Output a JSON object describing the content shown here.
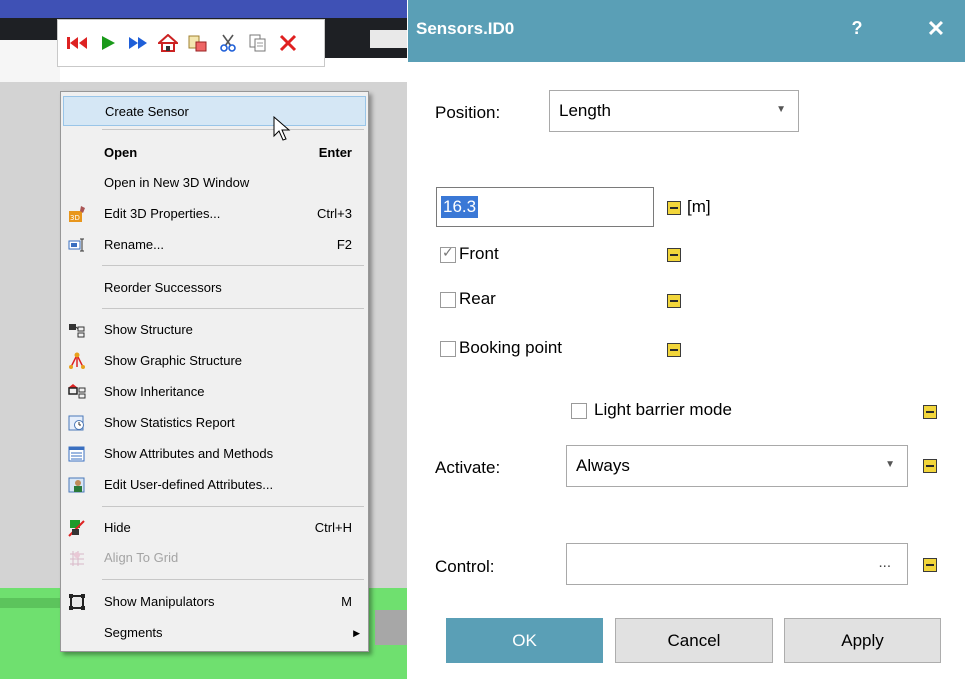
{
  "toolbar": {
    "icons": [
      "reset-icon",
      "play-icon",
      "fast-forward-icon",
      "home-icon",
      "paste-special-icon",
      "cut-icon",
      "copy-icon",
      "delete-icon"
    ]
  },
  "context_menu": {
    "items": [
      {
        "label": "Create Sensor",
        "shortcut": "",
        "icon": "",
        "bold": false,
        "disabled": false,
        "highlighted": true
      },
      {
        "label": "Open",
        "shortcut": "Enter",
        "icon": "",
        "bold": true,
        "disabled": false
      },
      {
        "label": "Open in New 3D Window",
        "shortcut": "",
        "icon": "",
        "bold": false,
        "disabled": false
      },
      {
        "label": "Edit 3D Properties...",
        "shortcut": "Ctrl+3",
        "icon": "3d-properties-icon",
        "bold": false,
        "disabled": false
      },
      {
        "label": "Rename...",
        "shortcut": "F2",
        "icon": "rename-icon",
        "bold": false,
        "disabled": false
      },
      {
        "label": "Reorder Successors",
        "shortcut": "",
        "icon": "",
        "bold": false,
        "disabled": false
      },
      {
        "label": "Show Structure",
        "shortcut": "",
        "icon": "structure-icon",
        "bold": false,
        "disabled": false
      },
      {
        "label": "Show Graphic Structure",
        "shortcut": "",
        "icon": "graphic-structure-icon",
        "bold": false,
        "disabled": false
      },
      {
        "label": "Show Inheritance",
        "shortcut": "",
        "icon": "inheritance-icon",
        "bold": false,
        "disabled": false
      },
      {
        "label": "Show Statistics Report",
        "shortcut": "",
        "icon": "statistics-icon",
        "bold": false,
        "disabled": false
      },
      {
        "label": "Show Attributes and Methods",
        "shortcut": "",
        "icon": "attributes-icon",
        "bold": false,
        "disabled": false
      },
      {
        "label": "Edit User-defined Attributes...",
        "shortcut": "",
        "icon": "user-attributes-icon",
        "bold": false,
        "disabled": false
      },
      {
        "label": "Hide",
        "shortcut": "Ctrl+H",
        "icon": "hide-icon",
        "bold": false,
        "disabled": false
      },
      {
        "label": "Align To Grid",
        "shortcut": "",
        "icon": "align-grid-icon",
        "bold": false,
        "disabled": true
      },
      {
        "label": "Show Manipulators",
        "shortcut": "M",
        "icon": "manipulators-icon",
        "bold": false,
        "disabled": false
      },
      {
        "label": "Segments",
        "shortcut": "",
        "icon": "",
        "bold": false,
        "disabled": false,
        "submenu": true
      }
    ]
  },
  "dialog": {
    "title": "Sensors.ID0",
    "help": "?",
    "close": "✕",
    "position_label": "Position:",
    "position_value": "Length",
    "value": "16.3",
    "unit": "[m]",
    "front_label": "Front",
    "front_checked": true,
    "rear_label": "Rear",
    "rear_checked": false,
    "booking_label": "Booking point",
    "booking_checked": false,
    "light_barrier_label": "Light barrier mode",
    "light_barrier_checked": false,
    "activate_label": "Activate:",
    "activate_value": "Always",
    "control_label": "Control:",
    "control_value": "",
    "control_browse": "...",
    "ok": "OK",
    "cancel": "Cancel",
    "apply": "Apply"
  },
  "colors": {
    "titlebar": "#5a9fb6",
    "menu_highlight": "#d5e7f5",
    "ground_green": "#6fe06f"
  }
}
